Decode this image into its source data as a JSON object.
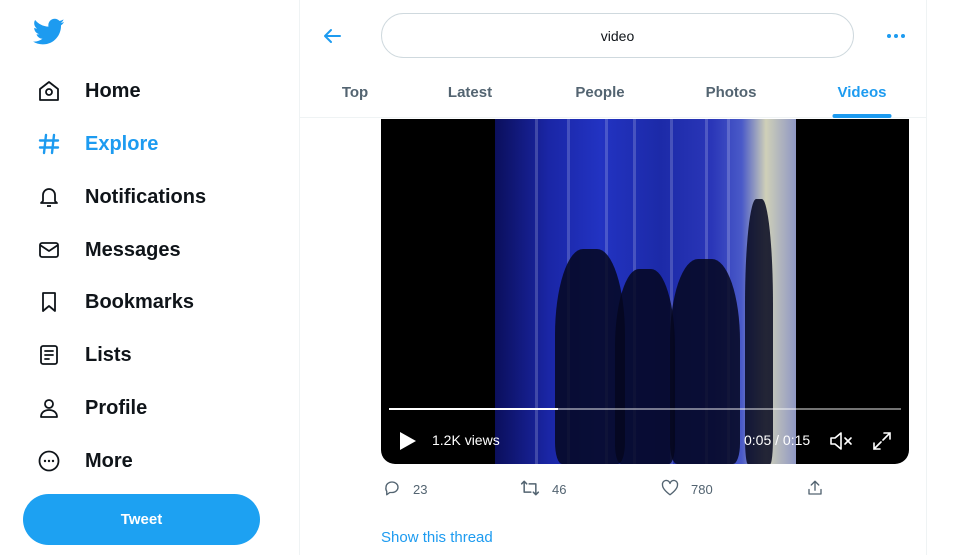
{
  "sidebar": {
    "items": [
      {
        "label": "Home",
        "icon": "home-icon"
      },
      {
        "label": "Explore",
        "icon": "hashtag-icon",
        "active": true
      },
      {
        "label": "Notifications",
        "icon": "bell-icon"
      },
      {
        "label": "Messages",
        "icon": "envelope-icon"
      },
      {
        "label": "Bookmarks",
        "icon": "bookmark-icon"
      },
      {
        "label": "Lists",
        "icon": "list-icon"
      },
      {
        "label": "Profile",
        "icon": "person-icon"
      },
      {
        "label": "More",
        "icon": "more-circle-icon"
      }
    ],
    "tweet_label": "Tweet"
  },
  "header": {
    "search_value": "video",
    "tabs": [
      {
        "label": "Top"
      },
      {
        "label": "Latest"
      },
      {
        "label": "People"
      },
      {
        "label": "Photos"
      },
      {
        "label": "Videos",
        "active": true
      }
    ]
  },
  "video": {
    "views": "1.2K views",
    "time": "0:05 / 0:15",
    "progress": 0.33
  },
  "actions": {
    "reply_count": "23",
    "retweet_count": "46",
    "like_count": "780"
  },
  "show_thread_label": "Show this thread",
  "colors": {
    "accent": "#1d9bf0",
    "tweet_button": "#1da1f2",
    "text": "#0f1419",
    "muted": "#536471"
  }
}
